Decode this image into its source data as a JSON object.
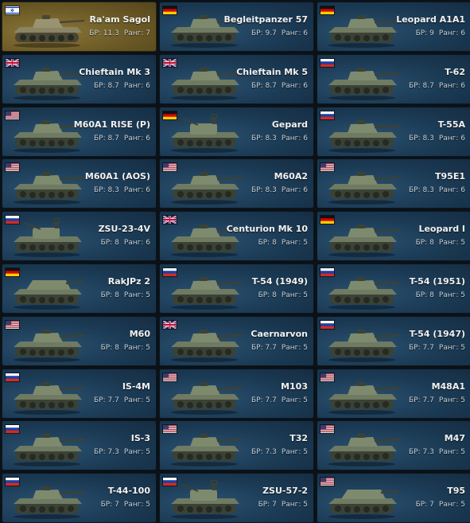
{
  "labels": {
    "br": "БР:",
    "rank": "Ранг:"
  },
  "colors": {
    "card_bg": "#1b3a54",
    "premium_bg": "#6b5a26",
    "text": "#f2f2f2"
  },
  "vehicles": [
    {
      "name": "Ra'am Sagol",
      "br": "11.3",
      "rank": "7",
      "nation": "israel",
      "premium": true,
      "icon": "tank-icon"
    },
    {
      "name": "Begleitpanzer 57",
      "br": "9.7",
      "rank": "6",
      "nation": "germany",
      "premium": false,
      "icon": "tank-icon"
    },
    {
      "name": "Leopard A1A1",
      "br": "9",
      "rank": "6",
      "nation": "germany",
      "premium": false,
      "icon": "tank-icon"
    },
    {
      "name": "Chieftain Mk 3",
      "br": "8.7",
      "rank": "6",
      "nation": "uk",
      "premium": false,
      "icon": "tank-icon"
    },
    {
      "name": "Chieftain Mk 5",
      "br": "8.7",
      "rank": "6",
      "nation": "uk",
      "premium": false,
      "icon": "tank-icon"
    },
    {
      "name": "T-62",
      "br": "8.7",
      "rank": "6",
      "nation": "ussr",
      "premium": false,
      "icon": "tank-icon"
    },
    {
      "name": "M60A1 RISE (P)",
      "br": "8.7",
      "rank": "6",
      "nation": "usa",
      "premium": false,
      "icon": "tank-icon"
    },
    {
      "name": "Gepard",
      "br": "8.3",
      "rank": "6",
      "nation": "germany",
      "premium": false,
      "icon": "spaa-icon"
    },
    {
      "name": "T-55A",
      "br": "8.3",
      "rank": "6",
      "nation": "ussr",
      "premium": false,
      "icon": "tank-icon"
    },
    {
      "name": "M60A1 (AOS)",
      "br": "8.3",
      "rank": "6",
      "nation": "usa",
      "premium": false,
      "icon": "tank-icon"
    },
    {
      "name": "M60A2",
      "br": "8.3",
      "rank": "6",
      "nation": "usa",
      "premium": false,
      "icon": "tank-icon"
    },
    {
      "name": "T95E1",
      "br": "8.3",
      "rank": "6",
      "nation": "usa",
      "premium": false,
      "icon": "tank-icon"
    },
    {
      "name": "ZSU-23-4V",
      "br": "8",
      "rank": "6",
      "nation": "ussr",
      "premium": false,
      "icon": "spaa-icon"
    },
    {
      "name": "Centurion Mk 10",
      "br": "8",
      "rank": "5",
      "nation": "uk",
      "premium": false,
      "icon": "tank-icon"
    },
    {
      "name": "Leopard I",
      "br": "8",
      "rank": "5",
      "nation": "germany",
      "premium": false,
      "icon": "tank-icon"
    },
    {
      "name": "RakJPz 2",
      "br": "8",
      "rank": "5",
      "nation": "germany",
      "premium": false,
      "icon": "tank-destroyer-icon"
    },
    {
      "name": "T-54 (1949)",
      "br": "8",
      "rank": "5",
      "nation": "ussr",
      "premium": false,
      "icon": "tank-icon"
    },
    {
      "name": "T-54 (1951)",
      "br": "8",
      "rank": "5",
      "nation": "ussr",
      "premium": false,
      "icon": "tank-icon"
    },
    {
      "name": "M60",
      "br": "8",
      "rank": "5",
      "nation": "usa",
      "premium": false,
      "icon": "tank-icon"
    },
    {
      "name": "Caernarvon",
      "br": "7.7",
      "rank": "5",
      "nation": "uk",
      "premium": false,
      "icon": "tank-icon"
    },
    {
      "name": "T-54 (1947)",
      "br": "7.7",
      "rank": "5",
      "nation": "ussr",
      "premium": false,
      "icon": "tank-icon"
    },
    {
      "name": "IS-4M",
      "br": "7.7",
      "rank": "5",
      "nation": "ussr",
      "premium": false,
      "icon": "tank-icon"
    },
    {
      "name": "M103",
      "br": "7.7",
      "rank": "5",
      "nation": "usa",
      "premium": false,
      "icon": "tank-icon"
    },
    {
      "name": "M48A1",
      "br": "7.7",
      "rank": "5",
      "nation": "usa",
      "premium": false,
      "icon": "tank-icon"
    },
    {
      "name": "IS-3",
      "br": "7.3",
      "rank": "5",
      "nation": "ussr",
      "premium": false,
      "icon": "tank-icon"
    },
    {
      "name": "T32",
      "br": "7.3",
      "rank": "5",
      "nation": "usa",
      "premium": false,
      "icon": "tank-icon"
    },
    {
      "name": "M47",
      "br": "7.3",
      "rank": "5",
      "nation": "usa",
      "premium": false,
      "icon": "tank-icon"
    },
    {
      "name": "T-44-100",
      "br": "7",
      "rank": "5",
      "nation": "ussr",
      "premium": false,
      "icon": "tank-icon"
    },
    {
      "name": "ZSU-57-2",
      "br": "7",
      "rank": "5",
      "nation": "ussr",
      "premium": false,
      "icon": "spaa-icon"
    },
    {
      "name": "T95",
      "br": "7",
      "rank": "5",
      "nation": "usa",
      "premium": false,
      "icon": "tank-destroyer-icon"
    }
  ]
}
